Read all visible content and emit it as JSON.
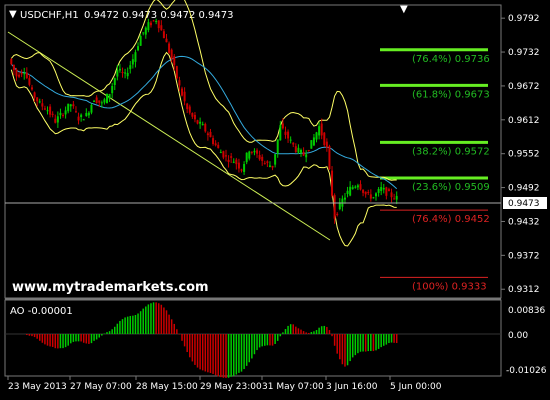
{
  "header": {
    "symbol_text": "USDCHF,H1",
    "ohlc_text": "0.9472 0.9473 0.9472 0.9473"
  },
  "price_axis": {
    "labels": [
      "0.9792",
      "0.9732",
      "0.9672",
      "0.9612",
      "0.9552",
      "0.9492",
      "0.9432",
      "0.9372",
      "0.9312"
    ],
    "current_price": "0.9473"
  },
  "fib_levels": [
    {
      "label": "(76.4%) 0.9736",
      "color": "#22bb22"
    },
    {
      "label": "(61.8%) 0.9673",
      "color": "#22bb22"
    },
    {
      "label": "(38.2%) 0.9572",
      "color": "#22bb22"
    },
    {
      "label": "(23.6%) 0.9509",
      "color": "#22bb22"
    },
    {
      "label": "(76.4%) 0.9452",
      "color": "#dd2222"
    },
    {
      "label": "(100%) 0.9333",
      "color": "#dd2222"
    }
  ],
  "watermark": "www.mytrademarkets.com",
  "ao_panel": {
    "title": "AO -0.00001",
    "labels": [
      "0.00836",
      "0.00",
      "-0.01026"
    ]
  },
  "time_axis": {
    "labels": [
      "23 May 2013",
      "27 May 07:00",
      "28 May 15:00",
      "29 May 23:00",
      "31 May 07:00",
      "3 Jun 16:00",
      "5 Jun 00:00"
    ]
  },
  "colors": {
    "background": "#000000",
    "bull_candle": "#00cc00",
    "bear_candle": "#cc0000",
    "bands": "#ffff66",
    "moving_average": "#33aadd",
    "trendline": "#ccee55",
    "fib_line": "#66ee22",
    "fib_line_red": "#dd2222",
    "ao_up": "#00cc00",
    "ao_down": "#cc0000"
  },
  "chart_data": {
    "type": "candlestick",
    "symbol": "USDCHF",
    "timeframe": "H1",
    "ylim": [
      0.93,
      0.981
    ],
    "current_price": 0.9473,
    "fib_levels": [
      0.9736,
      0.9673,
      0.9572,
      0.9509,
      0.9452,
      0.9333
    ],
    "price_path": [
      0.972,
      0.969,
      0.97,
      0.966,
      0.964,
      0.963,
      0.961,
      0.9625,
      0.964,
      0.9615,
      0.962,
      0.965,
      0.964,
      0.966,
      0.97,
      0.969,
      0.972,
      0.976,
      0.978,
      0.979,
      0.976,
      0.972,
      0.967,
      0.963,
      0.961,
      0.96,
      0.958,
      0.956,
      0.9545,
      0.954,
      0.9525,
      0.956,
      0.955,
      0.9535,
      0.953,
      0.96,
      0.958,
      0.956,
      0.955,
      0.957,
      0.96,
      0.956,
      0.944,
      0.947,
      0.949,
      0.95,
      0.948,
      0.9475,
      0.949,
      0.948,
      0.9473
    ],
    "ao_range": [
      -0.01026,
      0.00836
    ]
  }
}
